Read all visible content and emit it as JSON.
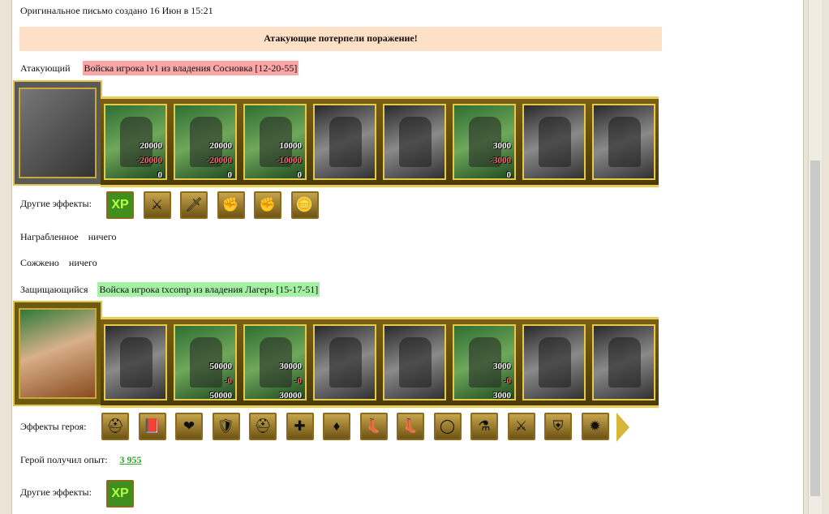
{
  "created_line": "Оригинальное письмо создано 16 Июн в 15:21",
  "banner": "Атакующие потерпели поражение!",
  "attacker": {
    "label": "Атакующий",
    "army": "Войска игрока lv1 из владения Сосновка [12-20-55]",
    "slots": [
      {
        "style": "color",
        "count": "20000",
        "loss": "-20000",
        "left": "0"
      },
      {
        "style": "color",
        "count": "20000",
        "loss": "-20000",
        "left": "0"
      },
      {
        "style": "color",
        "count": "10000",
        "loss": "-10000",
        "left": "0"
      },
      {
        "style": "grey"
      },
      {
        "style": "grey"
      },
      {
        "style": "color",
        "count": "3000",
        "loss": "-3000",
        "left": "0"
      },
      {
        "style": "grey"
      },
      {
        "style": "grey"
      }
    ],
    "other_effects_label": "Другие эффекты:",
    "effects": [
      "xp-icon",
      "boot-sword-icon",
      "sword-icon",
      "fist-sword-icon",
      "fist-sword-icon",
      "coins-icon"
    ],
    "plundered_label": "Награбленное",
    "plundered_value": "ничего",
    "burned_label": "Сожжено",
    "burned_value": "ничего"
  },
  "defender": {
    "label": "Защищающийся",
    "army": "Войска игрока txcomp из владения Лагерь [15-17-51]",
    "slots": [
      {
        "style": "grey"
      },
      {
        "style": "color",
        "count": "50000",
        "loss": "-0",
        "left": "50000"
      },
      {
        "style": "color",
        "count": "30000",
        "loss": "-0",
        "left": "30000"
      },
      {
        "style": "grey"
      },
      {
        "style": "grey"
      },
      {
        "style": "color",
        "count": "3000",
        "loss": "-0",
        "left": "3000"
      },
      {
        "style": "grey"
      },
      {
        "style": "grey"
      }
    ],
    "hero_effects_label": "Эффекты героя:",
    "hero_effects": [
      "helmet-grey-icon",
      "book-icon",
      "heart-icon",
      "shield-icon",
      "helmet-blue-icon",
      "medal-icon",
      "gem-icon",
      "boots-red-icon",
      "boots-gold-icon",
      "ring-icon",
      "flask-icon",
      "sword-gold-icon",
      "shield-cross-icon",
      "cannon-icon"
    ],
    "exp_label": "Герой получил опыт:",
    "exp_value": "3 955",
    "other_effects_label": "Другие эффекты:",
    "effects": [
      "xp-icon"
    ]
  },
  "xp_text": "XP"
}
